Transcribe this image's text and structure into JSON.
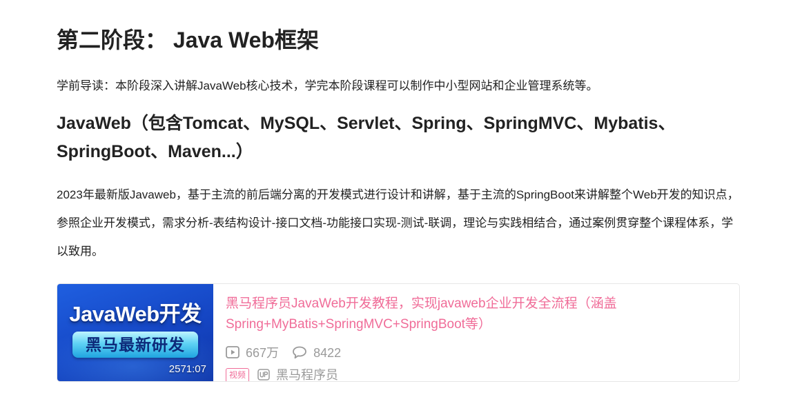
{
  "page": {
    "stage_title": "第二阶段： Java Web框架",
    "intro": "学前导读：本阶段深入讲解JavaWeb核心技术，学完本阶段课程可以制作中小型网站和企业管理系统等。",
    "section_title": "JavaWeb（包含Tomcat、MySQL、Servlet、Spring、SpringMVC、Mybatis、SpringBoot、Maven...）",
    "description": "2023年最新版Javaweb，基于主流的前后端分离的开发模式进行设计和讲解，基于主流的SpringBoot来讲解整个Web开发的知识点，参照企业开发模式，需求分析-表结构设计-接口文档-功能接口实现-测试-联调，理论与实践相结合，通过案例贯穿整个课程体系，学以致用。"
  },
  "video_card": {
    "thumbnail": {
      "title": "JavaWeb开发",
      "banner": "黑马最新研发",
      "duration": "2571:07"
    },
    "title": "黑马程序员JavaWeb开发教程，实现javaweb企业开发全流程（涵盖Spring+MyBatis+SpringMVC+SpringBoot等）",
    "plays": "667万",
    "comments": "8422",
    "badge": "视频",
    "author": "黑马程序员",
    "icons": {
      "plays": "play-count-icon",
      "comments": "comment-bubble-icon",
      "uploader": "up-uploader-icon"
    }
  },
  "colors": {
    "text": "#222222",
    "link_pink": "#f06c98",
    "meta_gray": "#9a9a9a",
    "thumb_blue": "#1546c4"
  }
}
